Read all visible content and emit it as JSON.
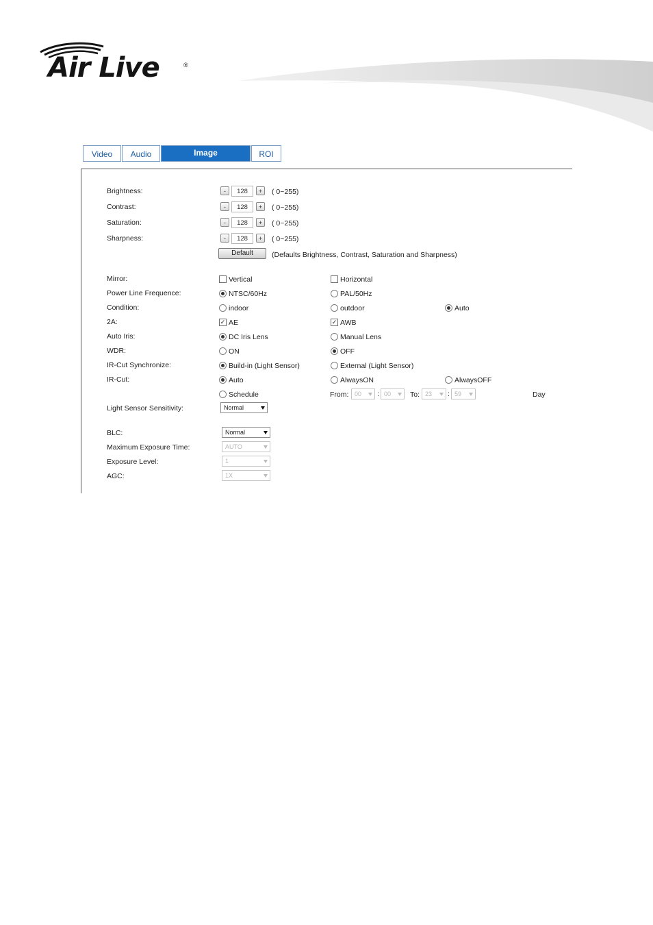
{
  "brand": {
    "name": "Air Live",
    "reg": "®"
  },
  "tabs": [
    "Video",
    "Audio",
    "Image",
    "ROI"
  ],
  "adjust": [
    {
      "label": "Brightness:",
      "value": "128",
      "range": "( 0~255)",
      "minus": "-",
      "plus": "+"
    },
    {
      "label": "Contrast:",
      "value": "128",
      "range": "( 0~255)",
      "minus": "-",
      "plus": "+"
    },
    {
      "label": "Saturation:",
      "value": "128",
      "range": "( 0~255)",
      "minus": "-",
      "plus": "+"
    },
    {
      "label": "Sharpness:",
      "value": "128",
      "range": "( 0~255)",
      "minus": "-",
      "plus": "+"
    }
  ],
  "default_button": "Default",
  "default_note": "(Defaults Brightness, Contrast, Saturation and Sharpness)",
  "mirror": {
    "label": "Mirror:",
    "vertical": "Vertical",
    "horizontal": "Horizontal",
    "vertical_checked": false,
    "horizontal_checked": false
  },
  "power": {
    "label": "Power Line Frequence:",
    "ntsc": "NTSC/60Hz",
    "pal": "PAL/50Hz",
    "selected": "ntsc"
  },
  "condition": {
    "label": "Condition:",
    "indoor": "indoor",
    "outdoor": "outdoor",
    "auto": "Auto",
    "selected": "auto"
  },
  "twoa": {
    "label": "2A:",
    "ae": "AE",
    "awb": "AWB",
    "ae_checked": true,
    "awb_checked": true
  },
  "auto_iris": {
    "label": "Auto Iris:",
    "dc": "DC Iris Lens",
    "manual": "Manual Lens",
    "selected": "dc"
  },
  "wdr": {
    "label": "WDR:",
    "on": "ON",
    "off": "OFF",
    "selected": "off"
  },
  "ircut_sync": {
    "label": "IR-Cut Synchronize:",
    "build": "Build-in (Light Sensor)",
    "external": "External (Light Sensor)",
    "selected": "build"
  },
  "ircut": {
    "label": "IR-Cut:",
    "auto": "Auto",
    "always_on": "AlwaysON",
    "always_off": "AlwaysOFF",
    "schedule": "Schedule",
    "selected": "auto",
    "from": "From:",
    "to": "To:",
    "from_h": "00",
    "from_m": "00",
    "to_h": "23",
    "to_m": "59",
    "sep": ":",
    "day": "Day"
  },
  "light_sensor": {
    "label": "Light Sensor Sensitivity:",
    "value": "Normal"
  },
  "blc": {
    "label": "BLC:",
    "value": "Normal"
  },
  "max_exposure": {
    "label": "Maximum Exposure Time:",
    "value": "AUTO"
  },
  "exposure_level": {
    "label": "Exposure Level:",
    "value": "1"
  },
  "agc": {
    "label": "AGC:",
    "value": "1X"
  }
}
